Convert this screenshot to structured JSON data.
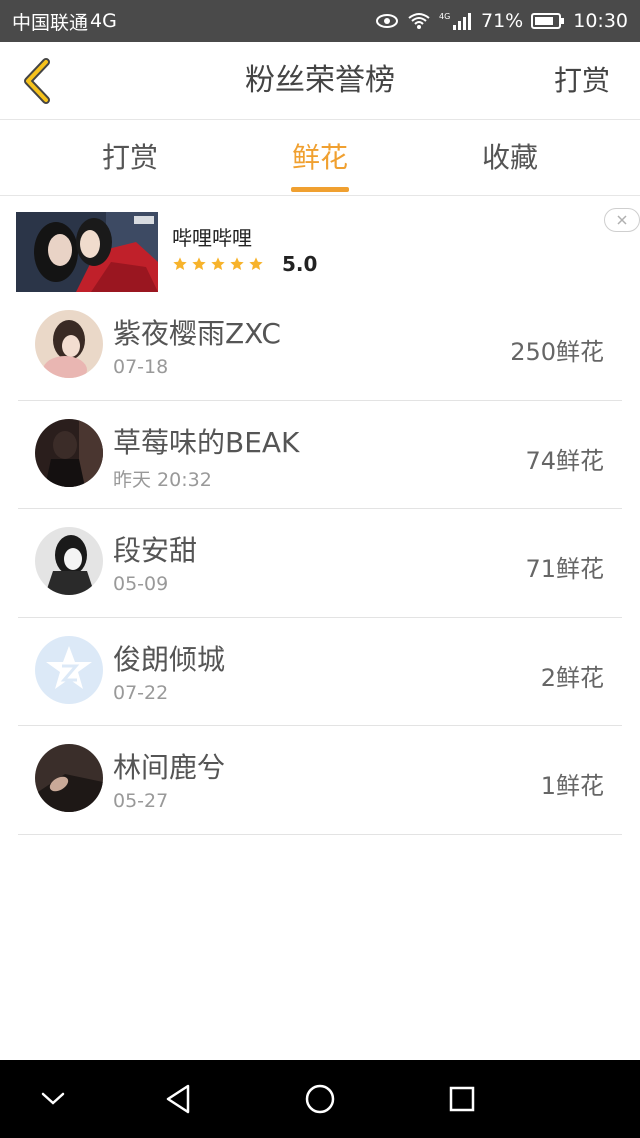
{
  "status_bar": {
    "carrier": "中国联通",
    "network": "4G",
    "signal_label": "4G",
    "battery": "71%",
    "time": "10:30"
  },
  "header": {
    "title": "粉丝荣誉榜",
    "right_action": "打赏",
    "back_icon": "chevron-left-icon"
  },
  "tabs": [
    {
      "label": "打赏",
      "active": false
    },
    {
      "label": "鲜花",
      "active": true
    },
    {
      "label": "收藏",
      "active": false
    }
  ],
  "ad": {
    "name": "哔哩哔哩",
    "stars": 5,
    "rating": "5.0"
  },
  "fans": [
    {
      "name": "紫夜樱雨ZXC",
      "time": "07-18",
      "count": "250鲜花"
    },
    {
      "name": "草莓味的BEAK",
      "time": "昨天 20:32",
      "count": "74鲜花"
    },
    {
      "name": "段安甜",
      "time": "05-09",
      "count": "71鲜花"
    },
    {
      "name": "俊朗倾城",
      "time": "07-22",
      "count": "2鲜花"
    },
    {
      "name": "林间鹿兮",
      "time": "05-27",
      "count": "1鲜花"
    }
  ],
  "colors": {
    "accent": "#f0a030",
    "status_bar": "#4a4a4a",
    "nav_bar": "#000000"
  }
}
